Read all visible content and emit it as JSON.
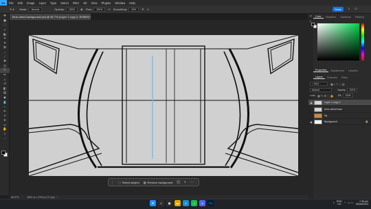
{
  "app": {
    "logo": "Ps",
    "menu": [
      "File",
      "Edit",
      "Image",
      "Layer",
      "Type",
      "Select",
      "Filter",
      "3D",
      "View",
      "Plugins",
      "Window",
      "Help"
    ]
  },
  "options": {
    "mode_label": "Mode:",
    "mode_value": "Normal",
    "opacity_label": "Opacity:",
    "opacity_value": "100%",
    "flow_label": "Flow:",
    "flow_value": "100%",
    "smoothing_label": "Smoothing:",
    "smoothing_value": "10%",
    "share_label": "Share"
  },
  "document": {
    "tab_title": "fenix airbnl background.psd @ 66.7% (Layer 1 copy 2, RGB/8*)",
    "zoom": "66.67%",
    "dimensions": "3840 px x 2160 px (72 ppi)"
  },
  "context_bar": {
    "select_subject": "Select subject",
    "remove_background": "Remove background"
  },
  "panels": {
    "top_tabs": [
      "Color",
      "Swatches",
      "Gradients",
      "Patterns"
    ],
    "mid_tabs": [
      "Properties",
      "Adjustments",
      "Libraries"
    ],
    "layer_tabs": [
      "Layers",
      "Channels",
      "Paths"
    ],
    "kind_label": "Kind",
    "blend_mode": "Normal",
    "opacity_label": "Opacity:",
    "opacity_value": "100%",
    "lock_label": "Lock:",
    "fill_label": "Fill:",
    "fill_value": "100%",
    "layers": [
      {
        "name": "Layer 1 copy 2",
        "selected": true,
        "visible": true,
        "group": false
      },
      {
        "name": "fenix airbnl base",
        "selected": false,
        "visible": false,
        "group": false
      },
      {
        "name": "bg",
        "selected": false,
        "visible": false,
        "group": true
      },
      {
        "name": "Background",
        "selected": false,
        "visible": true,
        "group": false
      }
    ]
  },
  "taskbar": {
    "weather_temp": "",
    "weather_desc": "",
    "lang": "ENG",
    "region": "US",
    "time": "7:46 pm",
    "date": "05/06/2024"
  },
  "colors": {
    "accent": "#1473e6",
    "canvas_bg": "#d0d0d0",
    "guide": "#87b6e3"
  }
}
